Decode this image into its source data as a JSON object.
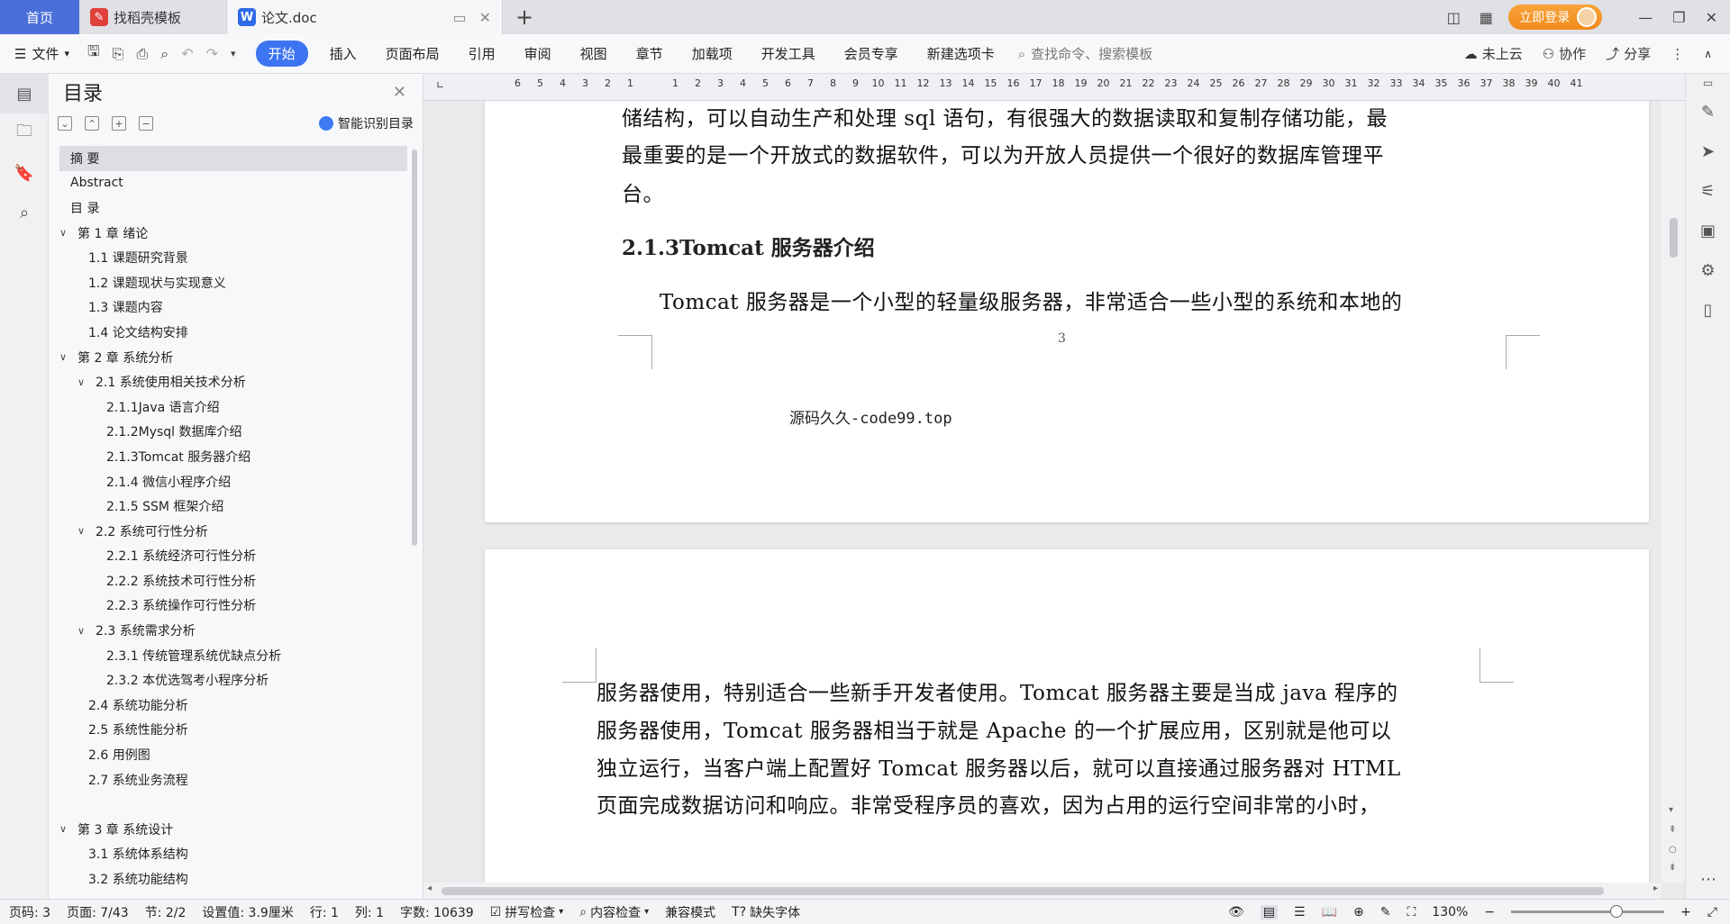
{
  "titlebar": {
    "home_tab": "首页",
    "tabs": [
      {
        "label": "找稻壳模板"
      },
      {
        "label": "论文.doc"
      }
    ],
    "login_button": "立即登录"
  },
  "ribbon": {
    "file_label": "文件",
    "menu": [
      "开始",
      "插入",
      "页面布局",
      "引用",
      "审阅",
      "视图",
      "章节",
      "加载项",
      "开发工具",
      "会员专享",
      "新建选项卡"
    ],
    "search_placeholder": "查找命令、搜索模板",
    "cloud": "未上云",
    "collab": "协作",
    "share": "分享"
  },
  "toc": {
    "title": "目录",
    "smart_label": "智能识别目录",
    "items": [
      {
        "label": "摘    要"
      },
      {
        "label": "Abstract"
      },
      {
        "label": "目  录"
      },
      {
        "label": "第 1 章    绪论"
      },
      {
        "label": "1.1 课题研究背景"
      },
      {
        "label": "1.2 课题现状与实现意义"
      },
      {
        "label": "1.3 课题内容"
      },
      {
        "label": "1.4 论文结构安排"
      },
      {
        "label": "第 2 章    系统分析"
      },
      {
        "label": "2.1 系统使用相关技术分析"
      },
      {
        "label": "2.1.1Java 语言介绍"
      },
      {
        "label": "2.1.2Mysql 数据库介绍"
      },
      {
        "label": "2.1.3Tomcat 服务器介绍"
      },
      {
        "label": "2.1.4 微信小程序介绍"
      },
      {
        "label": "2.1.5 SSM 框架介绍"
      },
      {
        "label": "2.2 系统可行性分析"
      },
      {
        "label": "2.2.1 系统经济可行性分析"
      },
      {
        "label": "2.2.2 系统技术可行性分析"
      },
      {
        "label": "2.2.3 系统操作可行性分析"
      },
      {
        "label": "2.3 系统需求分析"
      },
      {
        "label": "2.3.1 传统管理系统优缺点分析"
      },
      {
        "label": "2.3.2 本优选驾考小程序分析"
      },
      {
        "label": "2.4 系统功能分析"
      },
      {
        "label": "2.5 系统性能分析"
      },
      {
        "label": "2.6 用例图"
      },
      {
        "label": "2.7 系统业务流程"
      },
      {
        "label": "第 3 章    系统设计"
      },
      {
        "label": "3.1 系统体系结构"
      },
      {
        "label": "3.2 系统功能结构"
      }
    ]
  },
  "ruler": {
    "numbers": [
      "6",
      "5",
      "4",
      "3",
      "2",
      "1",
      "",
      "1",
      "2",
      "3",
      "4",
      "5",
      "6",
      "7",
      "8",
      "9",
      "10",
      "11",
      "12",
      "13",
      "14",
      "15",
      "16",
      "17",
      "18",
      "19",
      "20",
      "21",
      "22",
      "23",
      "24",
      "25",
      "26",
      "27",
      "28",
      "29",
      "30",
      "31",
      "32",
      "33",
      "34",
      "35",
      "36",
      "37",
      "38",
      "39",
      "40",
      "41"
    ]
  },
  "document": {
    "page1": {
      "line0": "储结构，可以自动生产和处理 sql 语句，有很强大的数据读取和复制存储功能，最",
      "line1": "最重要的是一个开放式的数据软件，可以为开放人员提供一个很好的数据库管理平",
      "line2": "台。",
      "heading": "2.1.3Tomcat 服务器介绍",
      "line3": "Tomcat 服务器是一个小型的轻量级服务器，非常适合一些小型的系统和本地的",
      "page_number": "3",
      "footer": "源码久久-code99.top"
    },
    "page2": {
      "line0": "服务器使用，特别适合一些新手开发者使用。Tomcat 服务器主要是当成 java 程序的",
      "line1": "服务器使用，Tomcat 服务器相当于就是 Apache 的一个扩展应用，区别就是他可以",
      "line2": "独立运行，当客户端上配置好 Tomcat 服务器以后，就可以直接通过服务器对 HTML",
      "line3": "页面完成数据访问和响应。非常受程序员的喜欢，因为占用的运行空间非常的小时，"
    }
  },
  "status": {
    "page_code": "页码: 3",
    "page": "页面: 7/43",
    "section": "节: 2/2",
    "setting": "设置值: 3.9厘米",
    "row": "行: 1",
    "col": "列: 1",
    "words": "字数: 10639",
    "spell": "拼写检查",
    "content": "内容检查",
    "compat": "兼容模式",
    "font_missing": "缺失字体",
    "zoom": "130%"
  },
  "colors": {
    "accent": "#3d74f2",
    "home_tab": "#4a6fd8",
    "login": "#f08a1a"
  }
}
